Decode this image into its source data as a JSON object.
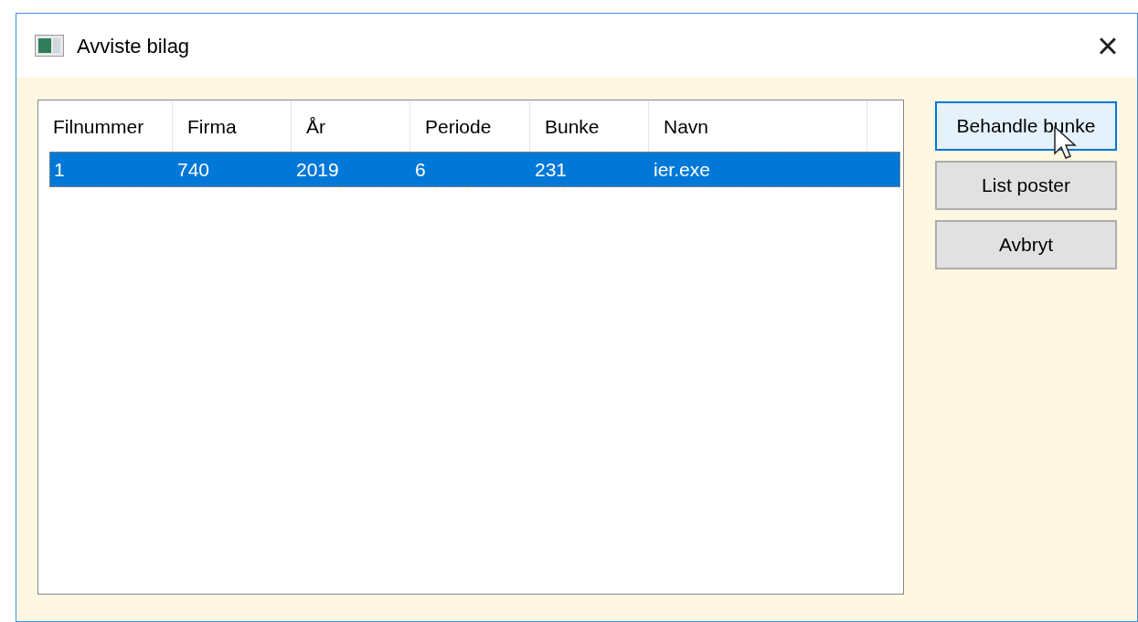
{
  "window": {
    "title": "Avviste bilag",
    "close": "×"
  },
  "table": {
    "columns": [
      "Filnummer",
      "Firma",
      "År",
      "Periode",
      "Bunke",
      "Navn"
    ],
    "rows": [
      {
        "selected": true,
        "cells": [
          "1",
          "740",
          "2019",
          "6",
          "231",
          "ier.exe"
        ]
      }
    ]
  },
  "buttons": [
    {
      "label": "Behandle bunke",
      "hovered": true
    },
    {
      "label": "List poster",
      "hovered": false
    },
    {
      "label": "Avbryt",
      "hovered": false
    }
  ]
}
